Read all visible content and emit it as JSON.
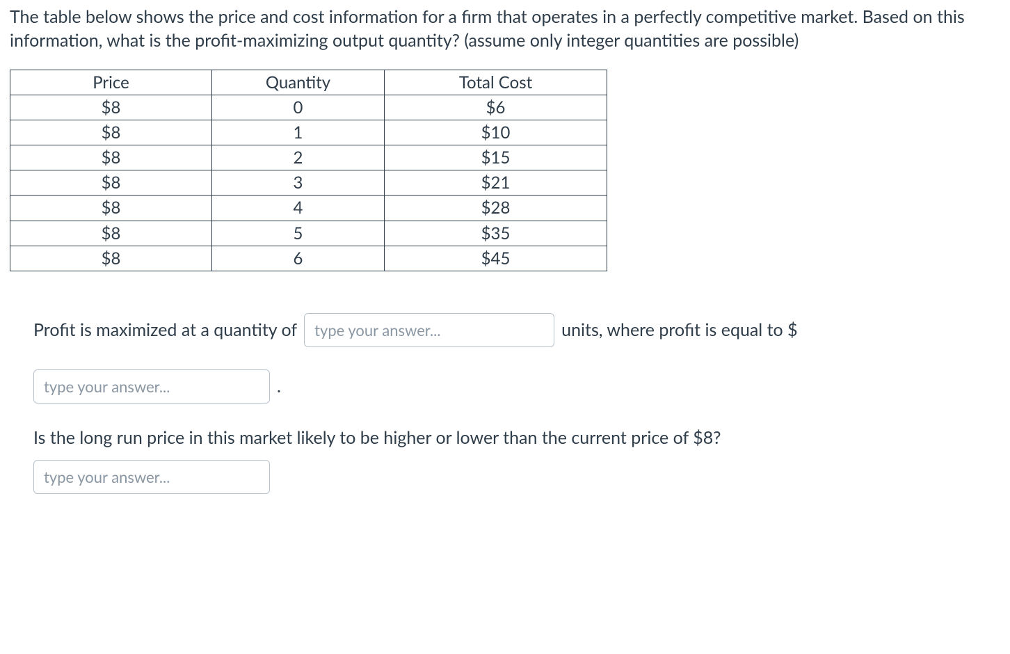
{
  "question": "The table below shows the price and cost information for a firm that operates in a perfectly competitive market. Based on this information, what is the profit-maximizing output quantity? (assume only integer quantities are possible)",
  "table": {
    "headers": [
      "Price",
      "Quantity",
      "Total Cost"
    ],
    "rows": [
      {
        "price": "$8",
        "quantity": "0",
        "total_cost": "$6"
      },
      {
        "price": "$8",
        "quantity": "1",
        "total_cost": "$10"
      },
      {
        "price": "$8",
        "quantity": "2",
        "total_cost": "$15"
      },
      {
        "price": "$8",
        "quantity": "3",
        "total_cost": "$21"
      },
      {
        "price": "$8",
        "quantity": "4",
        "total_cost": "$28"
      },
      {
        "price": "$8",
        "quantity": "5",
        "total_cost": "$35"
      },
      {
        "price": "$8",
        "quantity": "6",
        "total_cost": "$45"
      }
    ]
  },
  "answers": {
    "line1_prefix": "Profit is maximized at a quantity of",
    "line1_suffix": "units, where profit is equal to $",
    "period": ".",
    "question2": "Is the long run price in this market likely to be higher or lower than the current price of $8?",
    "input_placeholder": "type your answer..."
  }
}
